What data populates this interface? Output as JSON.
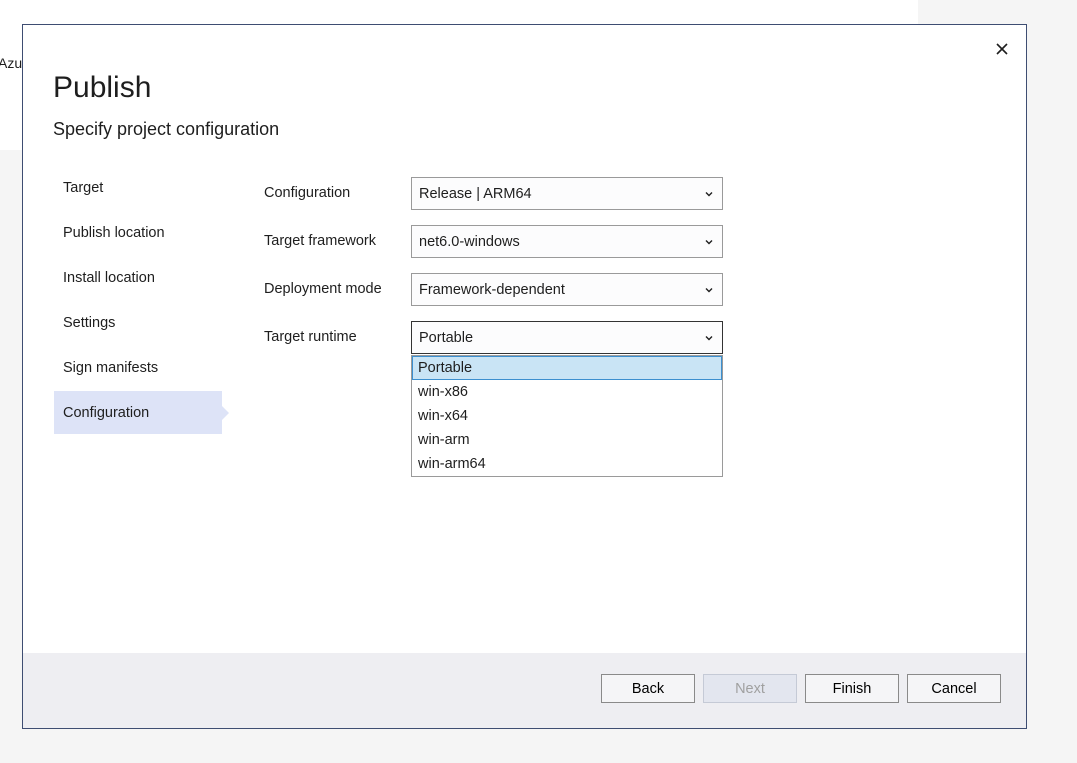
{
  "background": {
    "text": "Azur"
  },
  "dialog": {
    "title": "Publish",
    "subtitle": "Specify project configuration"
  },
  "nav": {
    "items": [
      {
        "label": "Target",
        "selected": false
      },
      {
        "label": "Publish location",
        "selected": false
      },
      {
        "label": "Install location",
        "selected": false
      },
      {
        "label": "Settings",
        "selected": false
      },
      {
        "label": "Sign manifests",
        "selected": false
      },
      {
        "label": "Configuration",
        "selected": true
      }
    ]
  },
  "form": {
    "configuration": {
      "label": "Configuration",
      "value": "Release | ARM64"
    },
    "target_framework": {
      "label": "Target framework",
      "value": "net6.0-windows"
    },
    "deployment_mode": {
      "label": "Deployment mode",
      "value": "Framework-dependent"
    },
    "target_runtime": {
      "label": "Target runtime",
      "value": "Portable",
      "options": [
        "Portable",
        "win-x86",
        "win-x64",
        "win-arm",
        "win-arm64"
      ]
    }
  },
  "footer": {
    "back_label": "Back",
    "next_label": "Next",
    "finish_label": "Finish",
    "cancel_label": "Cancel"
  },
  "icons": {
    "close": "close-icon",
    "chevron": "chevron-down-icon"
  },
  "colors": {
    "nav_selected": "#dde3f7",
    "option_highlight": "#c9e4f5",
    "option_highlight_border": "#3c8fcf",
    "footer_bg": "#eeeef2",
    "dialog_border": "#3e4d72"
  }
}
